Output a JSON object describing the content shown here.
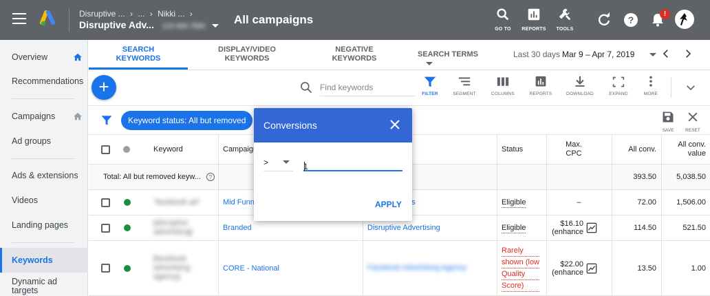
{
  "header": {
    "breadcrumb_top": [
      "Disruptive ...",
      "...",
      "Nikki ..."
    ],
    "account_name": "Disruptive Adv...",
    "account_id": "123-456-7890",
    "page_title": "All campaigns",
    "tools": [
      {
        "label": "GO TO",
        "icon": "search-icon"
      },
      {
        "label": "REPORTS",
        "icon": "reports-icon"
      },
      {
        "label": "TOOLS",
        "icon": "wrench-icon"
      }
    ],
    "notification_badge": "!"
  },
  "sidebar": {
    "items": [
      {
        "label": "Overview",
        "icon": "home-icon"
      },
      {
        "label": "Recommendations"
      },
      {
        "label": "Campaigns",
        "icon": "home-icon"
      },
      {
        "label": "Ad groups"
      },
      {
        "label": "Ads & extensions"
      },
      {
        "label": "Videos"
      },
      {
        "label": "Landing pages"
      },
      {
        "label": "Keywords",
        "active": true
      },
      {
        "label": "Dynamic ad targets"
      }
    ]
  },
  "tabs": [
    {
      "line1": "SEARCH",
      "line2": "KEYWORDS",
      "active": true
    },
    {
      "line1": "DISPLAY/VIDEO",
      "line2": "KEYWORDS"
    },
    {
      "line1": "NEGATIVE",
      "line2": "KEYWORDS"
    },
    {
      "line1": "SEARCH TERMS",
      "line2": ""
    }
  ],
  "date_range": {
    "label": "Last 30 days",
    "value": "Mar 9 – Apr 7, 2019"
  },
  "toolbar": {
    "add_label": "+",
    "search_placeholder": "Find keywords",
    "buttons": [
      {
        "label": "FILTER",
        "icon": "filter-icon",
        "active": true
      },
      {
        "label": "SEGMENT",
        "icon": "segment-icon"
      },
      {
        "label": "COLUMNS",
        "icon": "columns-icon"
      },
      {
        "label": "REPORTS",
        "icon": "reports-icon"
      },
      {
        "label": "DOWNLOAD",
        "icon": "download-icon"
      },
      {
        "label": "EXPAND",
        "icon": "expand-icon"
      },
      {
        "label": "MORE",
        "icon": "more-icon"
      }
    ]
  },
  "filter": {
    "chip": "Keyword status: All but removed",
    "save_label": "SAVE",
    "reset_label": "RESET"
  },
  "table": {
    "headers": {
      "keyword": "Keyword",
      "campaign": "Campaign",
      "status": "Status",
      "max_cpc": "Max. CPC",
      "all_conv": "All conv.",
      "all_conv_value": "All conv. value"
    },
    "total": {
      "label": "Total: All but removed keyw...",
      "all_conv": "393.50",
      "all_conv_value": "5,038.50"
    },
    "rows": [
      {
        "keyword": "\"facebook ad\"",
        "campaign": "Mid Funnel",
        "ad_group": "Facebook Ads",
        "status": "Eligible",
        "status_red": false,
        "max_cpc": "–",
        "max_cpc_sub": "",
        "all_conv": "72.00",
        "all_conv_value": "1,506.00",
        "status_color": "#1e8e3e"
      },
      {
        "keyword": "[disruptive advertising]",
        "campaign": "Branded",
        "ad_group": "Disruptive Advertising",
        "status": "Eligible",
        "status_red": false,
        "max_cpc": "$16.10",
        "max_cpc_sub": "(enhance",
        "all_conv": "114.50",
        "all_conv_value": "521.50",
        "status_color": "#1e8e3e"
      },
      {
        "keyword": "[facebook advertising agency]",
        "campaign": "CORE - National",
        "ad_group": "Facebook Advertising Agency",
        "status_lines": [
          "Rarely",
          "shown (low",
          "Quality",
          "Score)"
        ],
        "status_red": true,
        "max_cpc": "$22.00",
        "max_cpc_sub": "(enhance",
        "all_conv": "13.50",
        "all_conv_value": "1.00",
        "status_color": "#1e8e3e"
      }
    ]
  },
  "dialog": {
    "title": "Conversions",
    "operator": ">",
    "value": "1",
    "apply_label": "APPLY"
  },
  "colors": {
    "header_bg": "#5f6368",
    "accent": "#1a73e8",
    "dialog_header": "#3367d6",
    "error": "#d93025",
    "eligible_dot": "#1e8e3e"
  }
}
